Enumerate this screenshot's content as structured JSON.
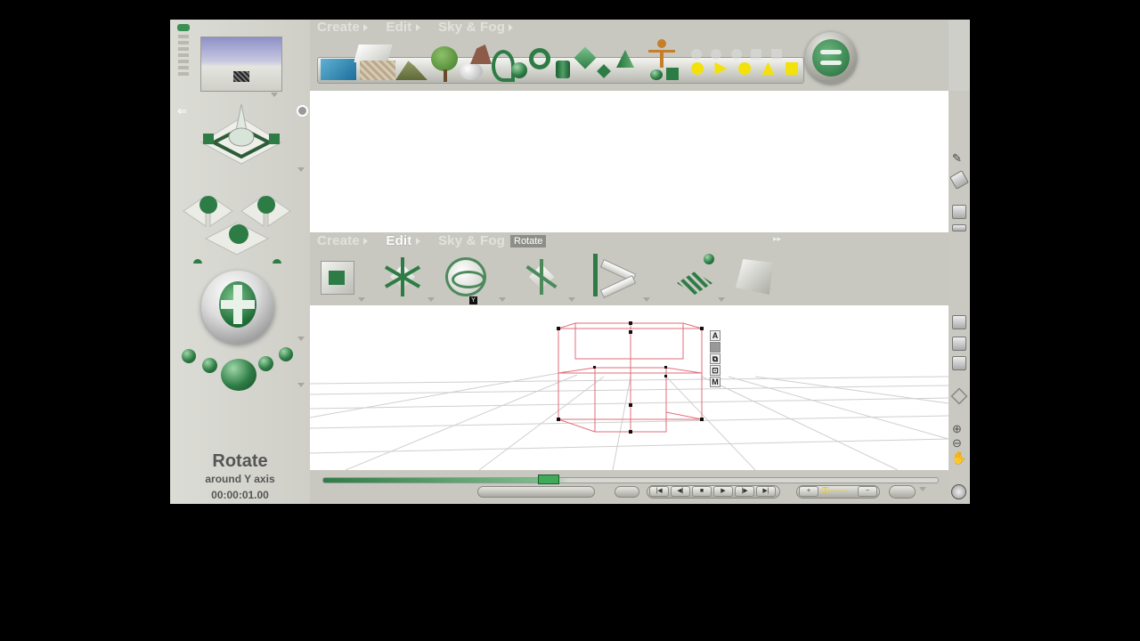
{
  "top_menu": {
    "items": [
      {
        "label": "Create",
        "active": false
      },
      {
        "label": "Edit",
        "active": false
      },
      {
        "label": "Sky & Fog",
        "active": false
      }
    ]
  },
  "lower_menu": {
    "items": [
      {
        "label": "Create",
        "active": false
      },
      {
        "label": "Edit",
        "active": true
      },
      {
        "label": "Sky & Fog",
        "active": false
      }
    ]
  },
  "tooltip": {
    "label": "Rotate"
  },
  "axis_badge": {
    "label": "Y"
  },
  "corner_tools": {
    "labels": [
      "A",
      "M"
    ]
  },
  "status": {
    "title": "Rotate",
    "subtitle": "around Y axis",
    "time": "00:00:01.00"
  },
  "colors": {
    "accent_green": "#2e7c45",
    "panel_bg": "#cfcfc9",
    "wireframe": "#e26d7a",
    "grid": "#cfcfcf"
  },
  "icons": {
    "create_toolbar": [
      "water-icon",
      "plane-icon",
      "ground-icon",
      "mountain-icon",
      "tree-icon",
      "rock-icon",
      "sphere-icon",
      "spiral-icon",
      "torus-icon",
      "cylinder-icon",
      "cube-icon",
      "cone-icon",
      "figure-icon",
      "primitives-icon"
    ],
    "edit_toolbar": [
      "move-object-icon",
      "scale-icon",
      "rotate-icon",
      "resize-icon",
      "align-icon",
      "duplicate-icon",
      "texture-icon"
    ],
    "side_tools": [
      "pencil-icon",
      "eraser-icon",
      "view-front-icon",
      "view-top-icon",
      "perspective-icon",
      "list-icon",
      "inbox-icon",
      "cube-view-icon",
      "zoom-in-icon",
      "zoom-out-icon",
      "hand-pan-icon",
      "globe-icon"
    ]
  }
}
